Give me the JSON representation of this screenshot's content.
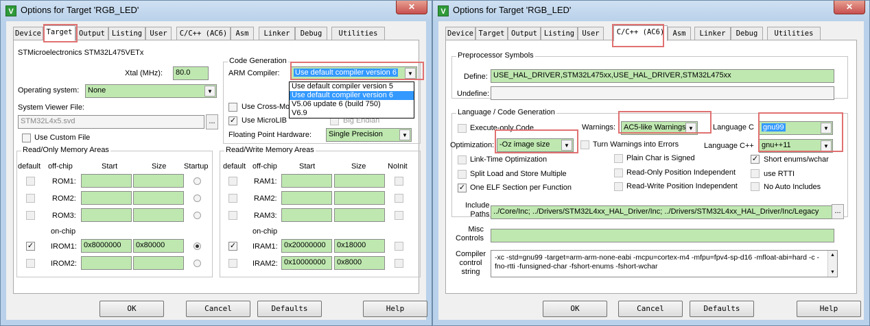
{
  "window_title": "Options for Target 'RGB_LED'",
  "close_glyph": "✕",
  "app_icon": "V",
  "left": {
    "tabs": [
      "Device",
      "Target",
      "Output",
      "Listing",
      "User",
      "C/C++ (AC6)",
      "Asm",
      "Linker",
      "Debug",
      "Utilities"
    ],
    "active_tab": "Target",
    "device": "STMicroelectronics STM32L475VETx",
    "xtal_label": "Xtal (MHz):",
    "xtal_value": "80.0",
    "os_label": "Operating system:",
    "os_value": "None",
    "svf_label": "System Viewer File:",
    "svf_value": "STM32L4x5.svd",
    "browse": "...",
    "use_custom_file": "Use Custom File",
    "codegen_title": "Code Generation",
    "arm_compiler_label": "ARM Compiler:",
    "arm_compiler_value": "Use default compiler version 6",
    "compiler_options": [
      "Use default compiler version 5",
      "Use default compiler version 6",
      "V5.06 update 6 (build 750)",
      "V6.9"
    ],
    "cross_module": "Use Cross-Mod",
    "microlib": "Use MicroLIB",
    "big_endian": "Big Endian",
    "fp_label": "Floating Point Hardware:",
    "fp_value": "Single Precision",
    "ro_title": "Read/Only Memory Areas",
    "rw_title": "Read/Write Memory Areas",
    "col_default": "default",
    "col_offchip": "off-chip",
    "col_start": "Start",
    "col_size": "Size",
    "col_startup": "Startup",
    "col_noinit": "NoInit",
    "on_chip": "on-chip",
    "rom_rows": [
      {
        "name": "ROM1:",
        "start": "",
        "size": ""
      },
      {
        "name": "ROM2:",
        "start": "",
        "size": ""
      },
      {
        "name": "ROM3:",
        "start": "",
        "size": ""
      },
      {
        "name": "IROM1:",
        "start": "0x8000000",
        "size": "0x80000"
      },
      {
        "name": "IROM2:",
        "start": "",
        "size": ""
      }
    ],
    "ram_rows": [
      {
        "name": "RAM1:",
        "start": "",
        "size": ""
      },
      {
        "name": "RAM2:",
        "start": "",
        "size": ""
      },
      {
        "name": "RAM3:",
        "start": "",
        "size": ""
      },
      {
        "name": "IRAM1:",
        "start": "0x20000000",
        "size": "0x18000"
      },
      {
        "name": "IRAM2:",
        "start": "0x10000000",
        "size": "0x8000"
      }
    ],
    "checked_mark": "✓"
  },
  "right": {
    "tabs": [
      "Device",
      "Target",
      "Output",
      "Listing",
      "User",
      "C/C++ (AC6)",
      "Asm",
      "Linker",
      "Debug",
      "Utilities"
    ],
    "active_tab": "C/C++ (AC6)",
    "preproc_title": "Preprocessor Symbols",
    "define_label": "Define:",
    "define_value": "USE_HAL_DRIVER,STM32L475xx,USE_HAL_DRIVER,STM32L475xx",
    "undefine_label": "Undefine:",
    "lang_title": "Language / Code Generation",
    "execute_only": "Execute-only Code",
    "warnings_label": "Warnings:",
    "warnings_value": "AC5-like Warnings",
    "language_c_label": "Language C",
    "language_c_value": "gnu99",
    "optimization_label": "Optimization:",
    "optimization_value": "-Oz image size",
    "turn_warnings": "Turn Warnings into Errors",
    "language_cpp_label": "Language C++",
    "language_cpp_value": "gnu++11",
    "link_time": "Link-Time Optimization",
    "plain_char": "Plain Char is Signed",
    "short_enums": "Short enums/wchar",
    "split_load": "Split Load and Store Multiple",
    "ro_pos": "Read-Only Position Independent",
    "use_rtti": "use RTTI",
    "one_elf": "One ELF Section per Function",
    "rw_pos": "Read-Write Position Independent",
    "no_auto": "No Auto Includes",
    "include_label_1": "Include",
    "include_label_2": "Paths",
    "include_value": "../Core/Inc; ../Drivers/STM32L4xx_HAL_Driver/Inc; ../Drivers/STM32L4xx_HAL_Driver/Inc/Legacy",
    "misc_label_1": "Misc",
    "misc_label_2": "Controls",
    "ccs_label_1": "Compiler",
    "ccs_label_2": "control",
    "ccs_label_3": "string",
    "ccs_value": "-xc -std=gnu99 -target=arm-arm-none-eabi -mcpu=cortex-m4 -mfpu=fpv4-sp-d16 -mfloat-abi=hard -c -fno-rtti -funsigned-char -fshort-enums -fshort-wchar",
    "checked_mark": "✓"
  },
  "buttons": {
    "ok": "OK",
    "cancel": "Cancel",
    "defaults": "Defaults",
    "help": "Help"
  }
}
